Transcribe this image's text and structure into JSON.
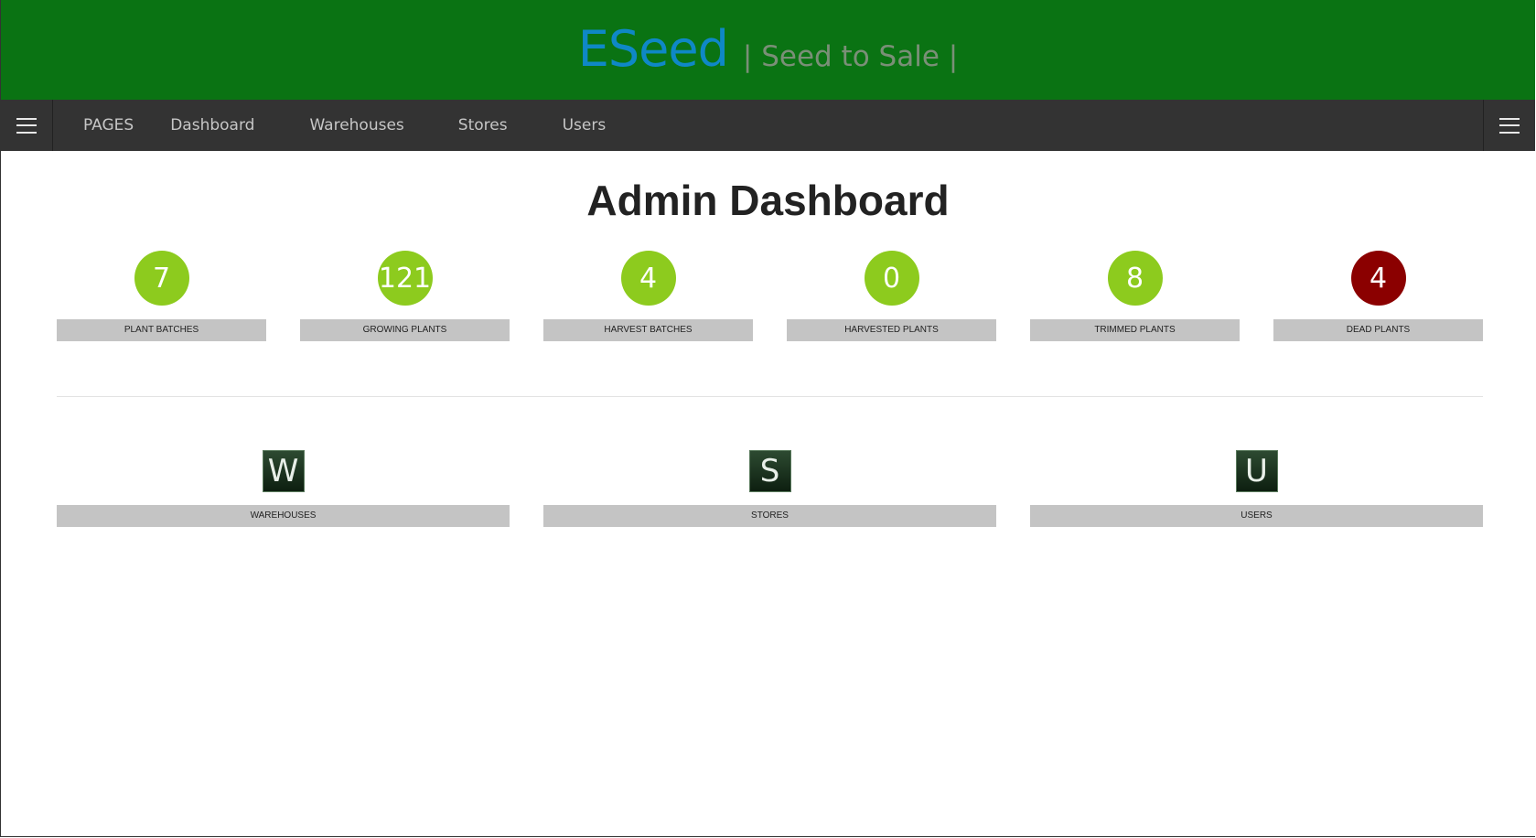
{
  "header": {
    "brand": "ESeed",
    "tagline": "| Seed to Sale |"
  },
  "nav": {
    "items": [
      {
        "label": "PAGES"
      },
      {
        "label": "Dashboard"
      },
      {
        "label": "Warehouses"
      },
      {
        "label": "Stores"
      },
      {
        "label": "Users"
      }
    ]
  },
  "page": {
    "title": "Admin Dashboard"
  },
  "stats": [
    {
      "value": "7",
      "label": "PLANT BATCHES",
      "color": "#8dcb1e"
    },
    {
      "value": "121",
      "label": "GROWING PLANTS",
      "color": "#8dcb1e"
    },
    {
      "value": "4",
      "label": "HARVEST BATCHES",
      "color": "#8dcb1e"
    },
    {
      "value": "0",
      "label": "HARVESTED PLANTS",
      "color": "#8dcb1e"
    },
    {
      "value": "8",
      "label": "TRIMMED PLANTS",
      "color": "#8dcb1e"
    },
    {
      "value": "4",
      "label": "DEAD PLANTS",
      "color": "#8b0000"
    }
  ],
  "links": [
    {
      "letter": "W",
      "label": "WAREHOUSES"
    },
    {
      "letter": "S",
      "label": "STORES"
    },
    {
      "letter": "U",
      "label": "USERS"
    }
  ],
  "colors": {
    "header_bg": "#0a7313",
    "brand": "#0f88c6",
    "navbar_bg": "#333333",
    "label_bg": "#c4c4c4"
  }
}
